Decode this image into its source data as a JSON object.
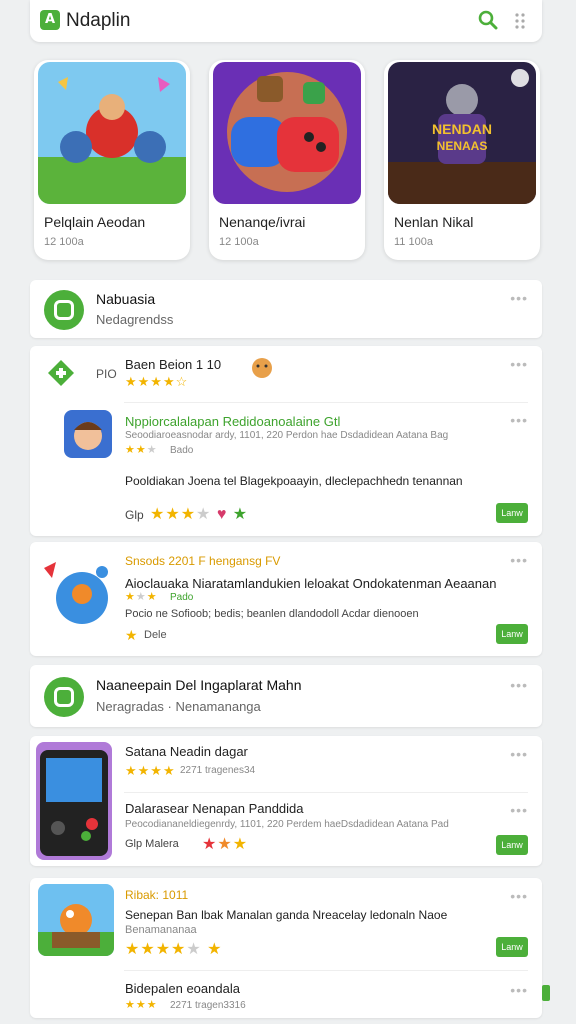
{
  "app": {
    "title": "Ndaplin",
    "logo_text": "A"
  },
  "featured": [
    {
      "title": "Pelqlain Aeodan",
      "sub": "12 100a"
    },
    {
      "title": "Nenanqe/ivrai",
      "sub": "12 100a"
    },
    {
      "title": "Nenlan Nikal",
      "sub": "11 100a",
      "overlay": "NENDAN NENAAS"
    }
  ],
  "section1": {
    "title": "Nabuasia",
    "sub": "Nedagrendss"
  },
  "item1": {
    "prefix": "PIO",
    "title": "Baen Beion 1 10",
    "stars": "★★★★☆"
  },
  "item2": {
    "title": "Nppiorcalalapan Redidoanoalaine Gtl",
    "desc": "Seoodiaroeasnodar ardy, 1101, 220 Perdon hae Dsdadidean Aatana Bag",
    "meta": "Bado",
    "desc2": "Pooldiakan Joena tel Blagekpoaayin, dleclepachhedn tenannan",
    "label": "Glp",
    "button": "Lanw"
  },
  "item3": {
    "title": "Snsods 2201 F hengansg FV",
    "desc": "Aioclauaka Niaratamlandukien leloakat Ondokatenman Aeaanan",
    "meta": "Pado",
    "desc2": "Pocio ne Sofioob; bedis; beanlen dlandodoll Acdar dienooen",
    "label": "Dele",
    "button": "Lanw"
  },
  "section2": {
    "title": "Naaneepain Del Ingaplarat Mahn",
    "sub": "Neragradas  ·  Nenamananga"
  },
  "item4": {
    "title": "Satana Neadin dagar",
    "meta": "2271 tragenes34",
    "title2": "Dalarasear Nenapan Panddida",
    "desc": "Peocodiananeldiegenrdy, 1101, 220 Perdem haeDsdadidean Aatana Pad",
    "label": "Glp Malera",
    "button": "Lanw"
  },
  "item5": {
    "title": "Ribak: 1011",
    "desc": "Senepan Ban lbak Manalan ganda Nreacelay ledonaln Naoe",
    "sub": "Benamananaa",
    "button": "Lanw",
    "title2": "Bidepalen eoandala",
    "meta2": "2271 tragen3316"
  },
  "colors": {
    "accent": "#4caf3a",
    "star": "#f2b400"
  }
}
